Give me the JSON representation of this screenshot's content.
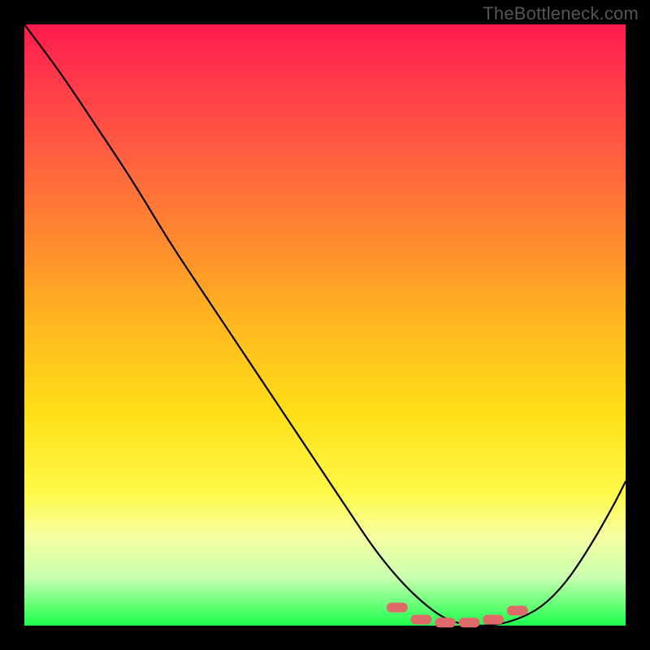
{
  "watermark": "TheBottleneck.com",
  "chart_data": {
    "type": "line",
    "title": "",
    "xlabel": "",
    "ylabel": "",
    "xlim": [
      0,
      100
    ],
    "ylim": [
      0,
      100
    ],
    "series": [
      {
        "name": "bottleneck-curve",
        "x": [
          0,
          6,
          12,
          18,
          24,
          30,
          36,
          42,
          48,
          54,
          58,
          62,
          66,
          70,
          74,
          78,
          82,
          86,
          90,
          94,
          98,
          100
        ],
        "values": [
          100,
          92,
          83,
          74,
          64,
          55,
          46,
          37,
          28,
          19,
          13,
          8,
          4,
          1,
          0,
          0,
          1,
          3,
          7,
          13,
          20,
          24
        ]
      }
    ],
    "markers": {
      "name": "trough-markers",
      "x": [
        62,
        66,
        70,
        74,
        78,
        82
      ],
      "values": [
        3,
        1,
        0.5,
        0.5,
        1,
        2.5
      ]
    },
    "gradient_stops": [
      {
        "pos": 0,
        "color": "#ff1a4d"
      },
      {
        "pos": 10,
        "color": "#ff3b4a"
      },
      {
        "pos": 22,
        "color": "#ff6040"
      },
      {
        "pos": 36,
        "color": "#ff8a2e"
      },
      {
        "pos": 50,
        "color": "#ffb81f"
      },
      {
        "pos": 65,
        "color": "#ffe017"
      },
      {
        "pos": 78,
        "color": "#fff94a"
      },
      {
        "pos": 85,
        "color": "#f7ffa0"
      },
      {
        "pos": 92,
        "color": "#c8ffb0"
      },
      {
        "pos": 100,
        "color": "#1cff4c"
      }
    ]
  }
}
